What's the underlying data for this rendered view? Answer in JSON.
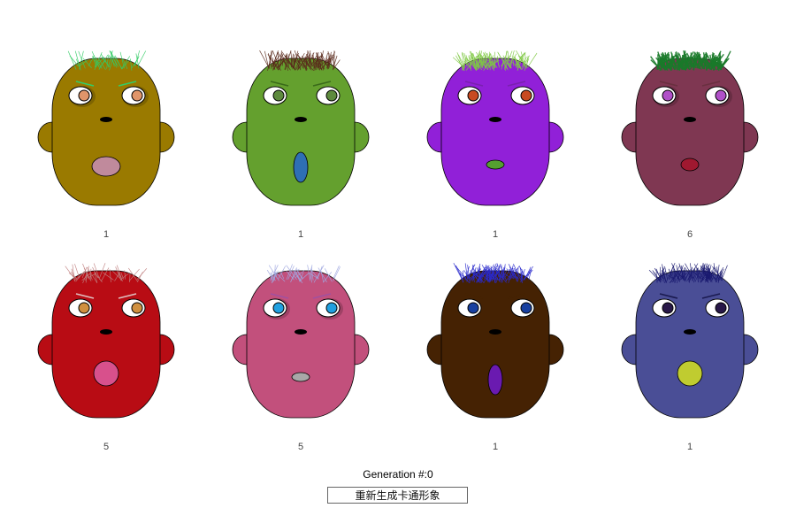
{
  "generation": {
    "label": "Generation #:0"
  },
  "regenerate_button": {
    "label": "重新生成卡通形象"
  },
  "faces": [
    {
      "id": "face-1",
      "score": "1",
      "skin": "#9a7a00",
      "hair": "#33cc66",
      "hair_style": "sparse",
      "brow": "#33cc66",
      "iris": "#e0956a",
      "eye_shadow": true,
      "mouth": {
        "shape": "wide",
        "color": "#c08a9c"
      }
    },
    {
      "id": "face-2",
      "score": "1",
      "skin": "#64a02e",
      "hair": "#5a2a1c",
      "hair_style": "dense",
      "brow": "#3a6a1a",
      "iris": "#5e8a3e",
      "eye_shadow": false,
      "mouth": {
        "shape": "tall",
        "color": "#2e6fb4"
      }
    },
    {
      "id": "face-3",
      "score": "1",
      "skin": "#9120d8",
      "hair": "#7fc844",
      "hair_style": "dense",
      "brow": "#7a20b0",
      "iris": "#c84a20",
      "eye_shadow": false,
      "mouth": {
        "shape": "flat",
        "color": "#55a030"
      }
    },
    {
      "id": "face-4",
      "score": "6",
      "skin": "#7f3752",
      "hair": "#1a7a2a",
      "hair_style": "thick",
      "brow": "#6a3040",
      "iris": "#b050c8",
      "eye_shadow": true,
      "mouth": {
        "shape": "small",
        "color": "#a01830"
      }
    },
    {
      "id": "face-5",
      "score": "5",
      "skin": "#b80c14",
      "hair": "#c08080",
      "hair_style": "sparse",
      "brow": "#e0c0c0",
      "iris": "#d09040",
      "eye_shadow": false,
      "mouth": {
        "shape": "round",
        "color": "#d8508c"
      }
    },
    {
      "id": "face-6",
      "score": "5",
      "skin": "#c2507c",
      "hair": "#a0a8e0",
      "hair_style": "sparse",
      "brow": "#a050a0",
      "iris": "#20a0e0",
      "eye_shadow": true,
      "mouth": {
        "shape": "flat",
        "color": "#a8a8a8"
      }
    },
    {
      "id": "face-7",
      "score": "1",
      "skin": "#452203",
      "hair": "#2a2acc",
      "hair_style": "dense",
      "brow": "#452203",
      "iris": "#1840a0",
      "eye_shadow": false,
      "mouth": {
        "shape": "tall",
        "color": "#6a1ab0"
      }
    },
    {
      "id": "face-8",
      "score": "1",
      "skin": "#4a4e96",
      "hair": "#1a1a70",
      "hair_style": "dense",
      "brow": "#1a1a50",
      "iris": "#281848",
      "eye_shadow": false,
      "mouth": {
        "shape": "round",
        "color": "#c0cc30"
      }
    }
  ]
}
